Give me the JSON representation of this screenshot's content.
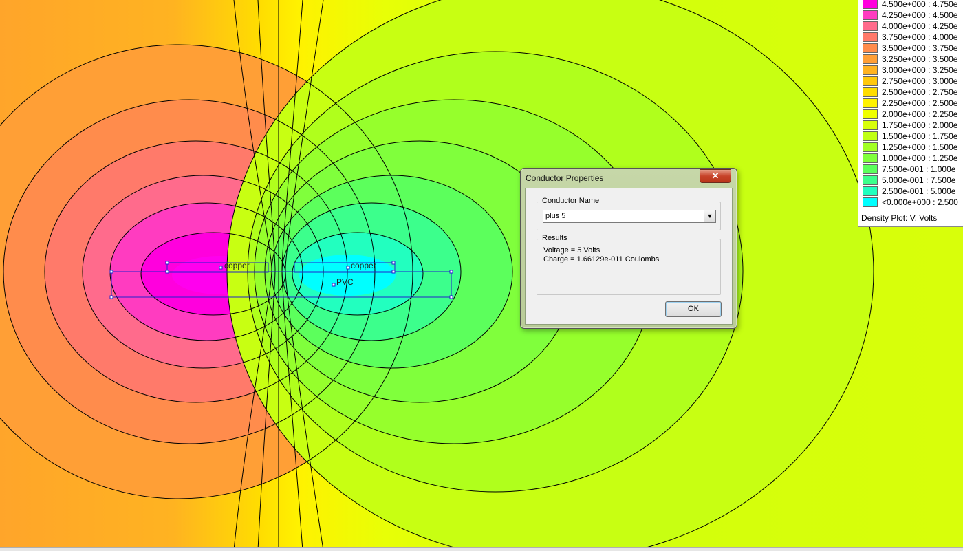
{
  "legend": {
    "title": "Density Plot: V, Volts",
    "entries": [
      {
        "label": "4.500e+000 : 4.750e",
        "color": "#ff00dd"
      },
      {
        "label": "4.250e+000 : 4.500e",
        "color": "#ff3cc0"
      },
      {
        "label": "4.000e+000 : 4.250e",
        "color": "#ff6b8c"
      },
      {
        "label": "3.750e+000 : 4.000e",
        "color": "#ff7a6a"
      },
      {
        "label": "3.500e+000 : 3.750e",
        "color": "#ff8c4c"
      },
      {
        "label": "3.250e+000 : 3.500e",
        "color": "#ff9f36"
      },
      {
        "label": "3.000e+000 : 3.250e",
        "color": "#ffb321"
      },
      {
        "label": "2.750e+000 : 3.000e",
        "color": "#ffc80c"
      },
      {
        "label": "2.500e+000 : 2.750e",
        "color": "#ffdd00"
      },
      {
        "label": "2.250e+000 : 2.500e",
        "color": "#fff200"
      },
      {
        "label": "2.000e+000 : 2.250e",
        "color": "#f0ff00"
      },
      {
        "label": "1.750e+000 : 2.000e",
        "color": "#d8ff0a"
      },
      {
        "label": "1.500e+000 : 1.750e",
        "color": "#c0ff14"
      },
      {
        "label": "1.250e+000 : 1.500e",
        "color": "#a2ff24"
      },
      {
        "label": "1.000e+000 : 1.250e",
        "color": "#80ff3c"
      },
      {
        "label": "7.500e-001 : 1.000e",
        "color": "#5cff5c"
      },
      {
        "label": "5.000e-001 : 7.500e",
        "color": "#3cff8c"
      },
      {
        "label": "2.500e-001 : 5.000e",
        "color": "#22ffbf"
      },
      {
        "label": "<0.000e+000 : 2.500",
        "color": "#00ffff"
      }
    ]
  },
  "plot": {
    "labels": {
      "copper_left": "copper",
      "copper_right": "copper",
      "pvc": "PVC"
    }
  },
  "dialog": {
    "title": "Conductor Properties",
    "close_glyph": "✕",
    "conductor_group_label": "Conductor Name",
    "conductor_value": "plus 5",
    "dropdown_glyph": "▼",
    "results_group_label": "Results",
    "voltage_text": "Voltage = 5 Volts",
    "charge_text": "Charge = 1.66129e-011 Coulombs",
    "ok_label": "OK"
  }
}
